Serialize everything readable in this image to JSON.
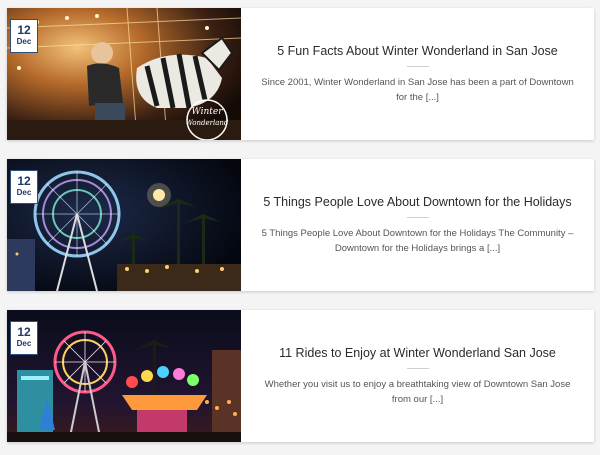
{
  "posts": [
    {
      "day": "12",
      "month": "Dec",
      "title": "5 Fun Facts About Winter Wonderland in San Jose",
      "excerpt": "Since 2001, Winter Wonderland in San Jose has been a part of  Downtown for the",
      "more": "[...]",
      "image_logo": "Winter Wonderland",
      "image_icon": "carousel-photo-icon"
    },
    {
      "day": "12",
      "month": "Dec",
      "title": "5 Things People Love About Downtown for the Holidays",
      "excerpt": "5 Things People Love About Downtown for the Holidays  The Community – Downtown for the Holidays brings a",
      "more": "[...]",
      "image_icon": "ferris-wheel-photo-icon"
    },
    {
      "day": "12",
      "month": "Dec",
      "title": "11 Rides to Enjoy at Winter Wonderland San Jose",
      "excerpt": "Whether you visit us to enjoy a breathtaking view of Downtown San Jose from our",
      "more": "[...]",
      "image_icon": "carnival-rides-photo-icon"
    }
  ],
  "colors": {
    "badge_text": "#1f3a68",
    "badge_border": "#2c4f7c",
    "title": "#2b2b2b",
    "excerpt": "#555555",
    "card_bg": "#ffffff",
    "page_bg": "#f4f4f4"
  }
}
